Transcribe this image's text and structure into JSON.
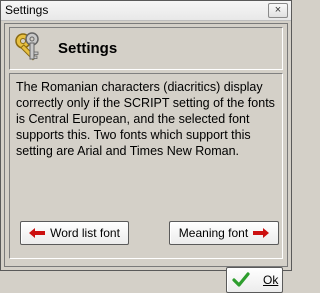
{
  "window": {
    "title": "Settings",
    "close_symbol": "×"
  },
  "header": {
    "title": "Settings",
    "icon": "keys-icon"
  },
  "message": "The Romanian characters (diacritics) display correctly only if the SCRIPT setting of the fonts is Central European, and the selected font supports this. Two fonts which support this setting are Arial and Times New Roman.",
  "buttons": {
    "word_list_font": "Word list font",
    "meaning_font": "Meaning font",
    "ok": "Ok"
  },
  "colors": {
    "arrow": "#cc1010",
    "check": "#2e9e2e"
  }
}
